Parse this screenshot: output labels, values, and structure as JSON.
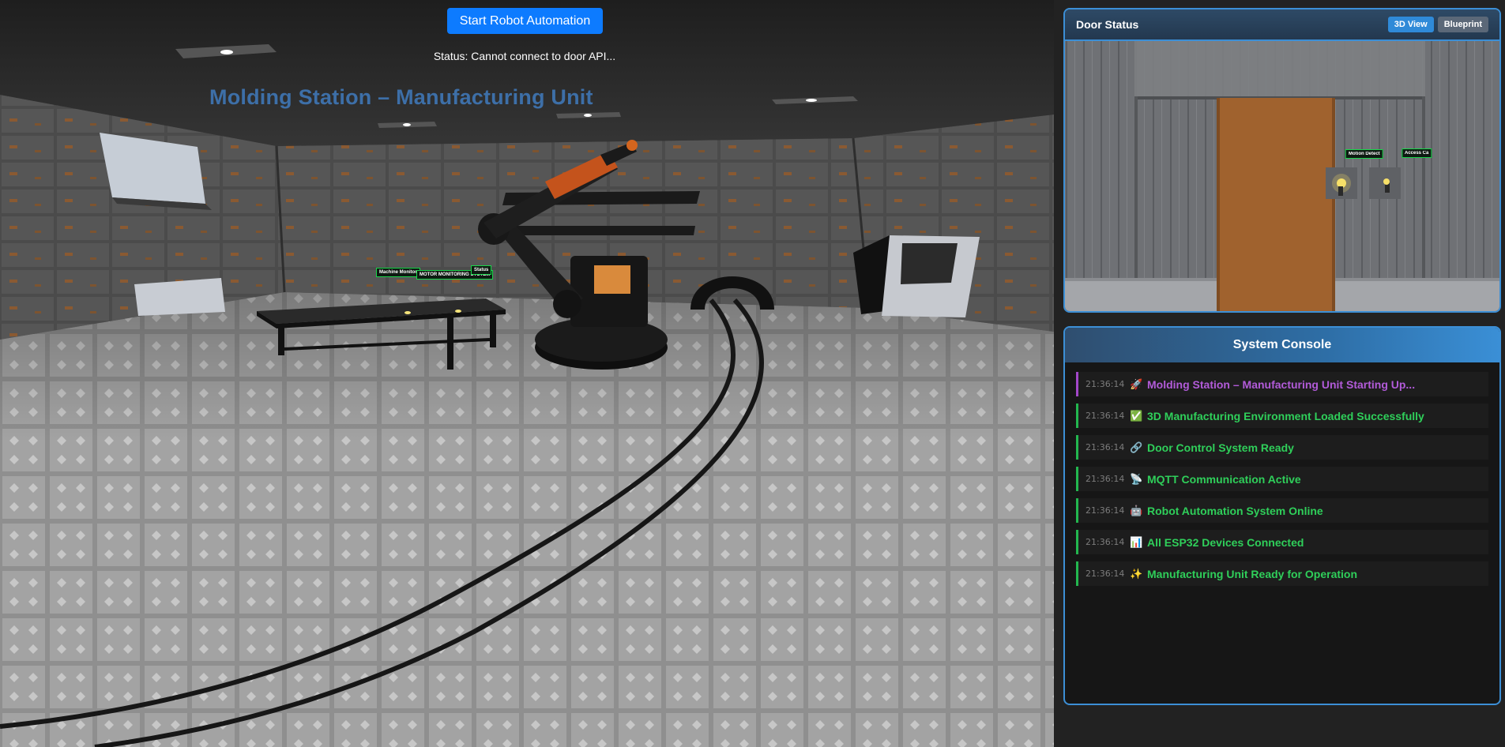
{
  "scene": {
    "start_button": "Start Robot Automation",
    "status": "Status: Cannot connect to door API...",
    "title": "Molding Station – Manufacturing Unit",
    "labels": [
      "Machine Monitor",
      "MOTOR MONITORING SYSTEM",
      "Status"
    ]
  },
  "door_panel": {
    "title": "Door Status",
    "view_3d": "3D View",
    "view_blueprint": "Blueprint",
    "labels": [
      "Motion Detect",
      "Access Ca"
    ]
  },
  "console": {
    "title": "System Console",
    "logs": [
      {
        "time": "21:36:14",
        "icon": "🚀",
        "message": "Molding Station – Manufacturing Unit Starting Up...",
        "kind": "startup"
      },
      {
        "time": "21:36:14",
        "icon": "✅",
        "message": "3D Manufacturing Environment Loaded Successfully",
        "kind": "ok"
      },
      {
        "time": "21:36:14",
        "icon": "🔗",
        "message": "Door Control System Ready",
        "kind": "ok"
      },
      {
        "time": "21:36:14",
        "icon": "📡",
        "message": "MQTT Communication Active",
        "kind": "ok"
      },
      {
        "time": "21:36:14",
        "icon": "🤖",
        "message": "Robot Automation System Online",
        "kind": "ok"
      },
      {
        "time": "21:36:14",
        "icon": "📊",
        "message": "All ESP32 Devices Connected",
        "kind": "ok"
      },
      {
        "time": "21:36:14",
        "icon": "✨",
        "message": "Manufacturing Unit Ready for Operation",
        "kind": "ok"
      }
    ]
  },
  "colors": {
    "accent_blue": "#0d7bff",
    "panel_border": "#3c8fd6",
    "log_ok": "#2fcf5a",
    "log_startup": "#b25bd9",
    "title_blue": "#3d6fa8"
  }
}
